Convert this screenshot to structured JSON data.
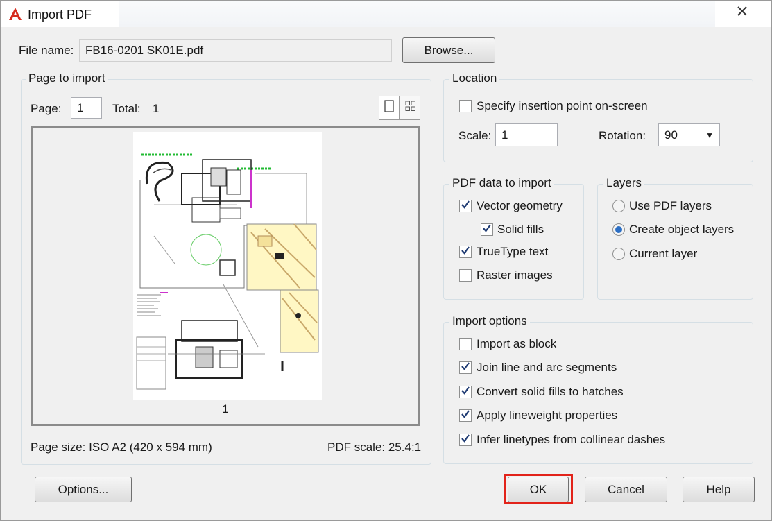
{
  "window": {
    "title": "Import PDF",
    "app_icon": "autocad-logo-icon",
    "close": "close-icon"
  },
  "file": {
    "label": "File name:",
    "value": "FB16-0201 SK01E.pdf",
    "browse": "Browse..."
  },
  "page_to_import": {
    "title": "Page to import",
    "page_label": "Page:",
    "page_value": "1",
    "total_label": "Total:",
    "total_value": "1",
    "thumb_label": "1",
    "page_size": "Page size: ISO A2 (420 x 594 mm)",
    "pdf_scale": "PDF scale: 25.4:1",
    "view_icons": [
      "single-page-icon",
      "grid-view-icon"
    ]
  },
  "location": {
    "title": "Location",
    "specify_label": "Specify insertion point on-screen",
    "specify_checked": false,
    "scale_label": "Scale:",
    "scale_value": "1",
    "rotation_label": "Rotation:",
    "rotation_value": "90"
  },
  "pdf_data": {
    "title": "PDF data to import",
    "items": [
      {
        "label": "Vector geometry",
        "checked": true
      },
      {
        "label": "Solid fills",
        "checked": true
      },
      {
        "label": "TrueType text",
        "checked": true
      },
      {
        "label": "Raster images",
        "checked": false
      }
    ]
  },
  "layers": {
    "title": "Layers",
    "options": [
      {
        "label": "Use PDF layers",
        "selected": false
      },
      {
        "label": "Create object layers",
        "selected": true
      },
      {
        "label": "Current layer",
        "selected": false
      }
    ]
  },
  "import_options": {
    "title": "Import options",
    "items": [
      {
        "label": "Import as block",
        "checked": false
      },
      {
        "label": "Join line and arc segments",
        "checked": true
      },
      {
        "label": "Convert solid fills to hatches",
        "checked": true
      },
      {
        "label": "Apply lineweight properties",
        "checked": true
      },
      {
        "label": "Infer linetypes from collinear dashes",
        "checked": true
      }
    ]
  },
  "buttons": {
    "options": "Options...",
    "ok": "OK",
    "cancel": "Cancel",
    "help": "Help"
  },
  "colors": {
    "highlight": "#e2231a",
    "accent": "#2c6fc4",
    "logo": "#d52b1e"
  }
}
